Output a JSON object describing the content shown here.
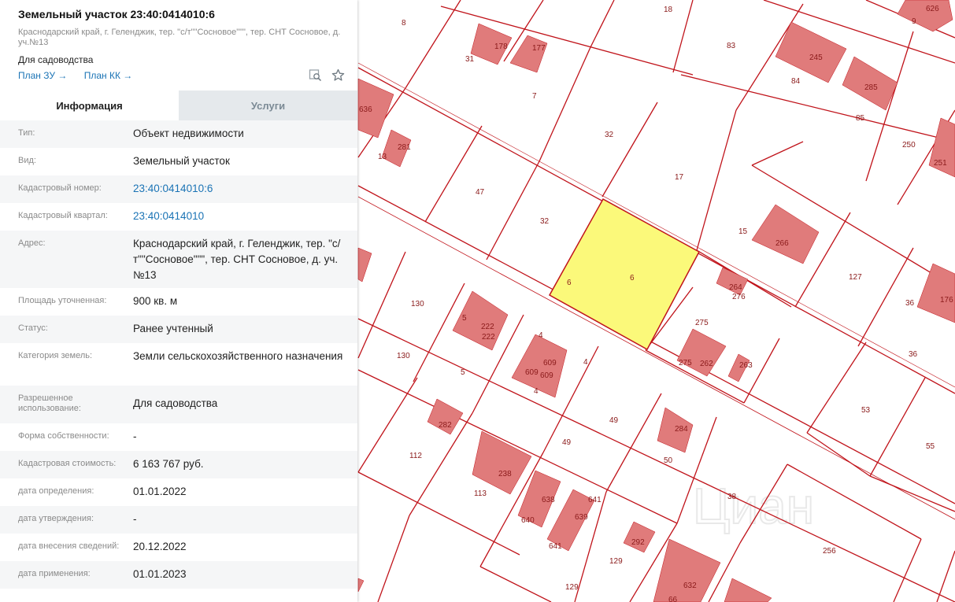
{
  "panel": {
    "title": "Земельный участок 23:40:0414010:6",
    "address_short": "Краснодарский край, г. Геленджик, тер. \"с/т\"\"Сосновое\"\"\", тер. СНТ Сосновое, д. уч.№13",
    "usage": "Для садоводства",
    "links": {
      "plan_zu": "План ЗУ →",
      "plan_kk": "План КК →"
    },
    "tabs": [
      {
        "label": "Информация"
      },
      {
        "label": "Услуги"
      }
    ],
    "rows": [
      {
        "label": "Тип:",
        "value": "Объект недвижимости"
      },
      {
        "label": "Вид:",
        "value": "Земельный участок"
      },
      {
        "label": "Кадастровый номер:",
        "value": "23:40:0414010:6"
      },
      {
        "label": "Кадастровый квартал:",
        "value": "23:40:0414010"
      },
      {
        "label": "Адрес:",
        "value": "Краснодарский край, г. Геленджик, тер. \"с/т\"\"Сосновое\"\"\", тер. СНТ Сосновое, д. уч.№13"
      },
      {
        "label": "Площадь уточненная:",
        "value": "900 кв. м"
      },
      {
        "label": "Статус:",
        "value": "Ранее учтенный"
      },
      {
        "label": "Категория земель:",
        "value": "Земли сельскохозяйственного назначения"
      },
      {
        "label": "Разрешенное использование:",
        "value": "Для садоводства"
      },
      {
        "label": "Форма собственности:",
        "value": "-"
      },
      {
        "label": "Кадастровая стоимость:",
        "value": "6 163 767 руб."
      },
      {
        "label": "дата определения:",
        "value": "01.01.2022"
      },
      {
        "label": "дата утверждения:",
        "value": "-"
      },
      {
        "label": "дата внесения сведений:",
        "value": "20.12.2022"
      },
      {
        "label": "дата применения:",
        "value": "01.01.2023"
      }
    ]
  },
  "map": {
    "colors": {
      "boundary": "#c0131a",
      "building": "#e07b7b",
      "selected": "#fbf97a",
      "label": "#8a1a1a"
    },
    "watermark": "Циан",
    "parcel_labels": [
      "8",
      "18",
      "626",
      "9",
      "31",
      "178",
      "177",
      "83",
      "245",
      "84",
      "285",
      "7",
      "85",
      "636",
      "32",
      "13",
      "281",
      "250",
      "251",
      "47",
      "17",
      "32",
      "15",
      "266",
      "6",
      "6",
      "264",
      "276",
      "127",
      "36",
      "176",
      "130",
      "5",
      "222",
      "222",
      "4",
      "275",
      "609",
      "609",
      "609",
      "4",
      "130",
      "5",
      "4",
      "275",
      "262",
      "263",
      "36",
      "53",
      "49",
      "282",
      "284",
      "112",
      "49",
      "50",
      "55",
      "238",
      "113",
      "38",
      "638",
      "641",
      "640",
      "639",
      "641",
      "256",
      "129",
      "292",
      "129",
      "632",
      "66"
    ]
  }
}
